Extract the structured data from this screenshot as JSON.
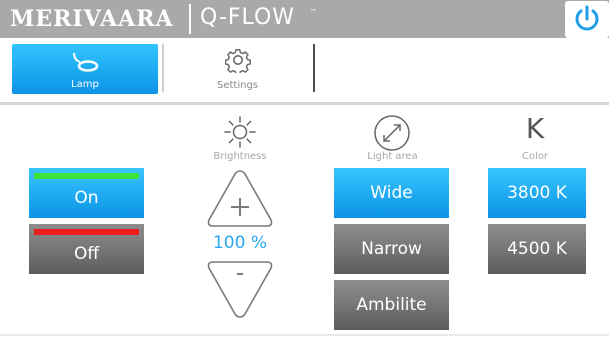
{
  "header": {
    "brand": "MERIVAARA",
    "product": "Q-FLOW",
    "trademark": "™",
    "power_icon": "power-icon"
  },
  "tabs": [
    {
      "label": "Lamp",
      "icon": "lamp-icon",
      "active": true
    },
    {
      "label": "Settings",
      "icon": "gear-icon",
      "active": false
    }
  ],
  "power": {
    "on_label": "On",
    "off_label": "Off",
    "on_indicator_color": "#3ee33e",
    "off_indicator_color": "#ee1c1c"
  },
  "brightness": {
    "label": "Brightness",
    "value": "100 %",
    "icon": "sun-icon",
    "up_symbol": "+",
    "down_symbol": "-"
  },
  "light_area": {
    "label": "Light area",
    "icon": "expand-diagonal-icon",
    "options": [
      "Wide",
      "Narrow",
      "Ambilite"
    ],
    "selected": "Wide"
  },
  "color": {
    "symbol": "K",
    "label": "Color",
    "options": [
      "3800 K",
      "4500 K"
    ],
    "selected": "3800 K"
  },
  "colors": {
    "accent": "#0c94e6",
    "inactive": "#6e6e6e",
    "header": "#a9a9a9"
  }
}
